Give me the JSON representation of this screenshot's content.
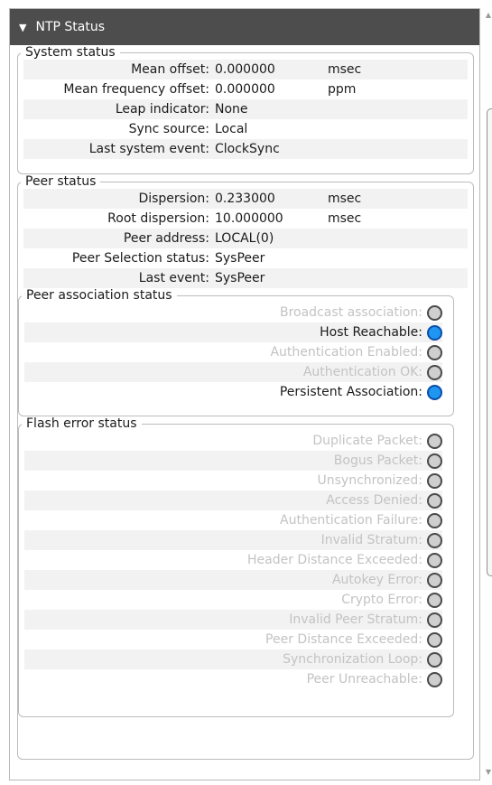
{
  "panel": {
    "title": "NTP Status"
  },
  "system_status": {
    "legend": "System status",
    "rows": [
      {
        "label": "Mean offset:",
        "value": "0.000000",
        "unit": "msec"
      },
      {
        "label": "Mean frequency offset:",
        "value": "0.000000",
        "unit": "ppm"
      },
      {
        "label": "Leap indicator:",
        "value": "None",
        "unit": ""
      },
      {
        "label": "Sync source:",
        "value": "Local",
        "unit": ""
      },
      {
        "label": "Last system event:",
        "value": "ClockSync",
        "unit": ""
      }
    ]
  },
  "peer_status": {
    "legend": "Peer status",
    "rows": [
      {
        "label": "Dispersion:",
        "value": "0.233000",
        "unit": "msec"
      },
      {
        "label": "Root dispersion:",
        "value": "10.000000",
        "unit": "msec"
      },
      {
        "label": "Peer address:",
        "value": "LOCAL(0)",
        "unit": ""
      },
      {
        "label": "Peer Selection status:",
        "value": "SysPeer",
        "unit": ""
      },
      {
        "label": "Last event:",
        "value": "SysPeer",
        "unit": ""
      }
    ],
    "association": {
      "legend": "Peer association status",
      "items": [
        {
          "label": "Broadcast association:",
          "active": false
        },
        {
          "label": "Host Reachable:",
          "active": true
        },
        {
          "label": "Authentication Enabled:",
          "active": false
        },
        {
          "label": "Authentication OK:",
          "active": false
        },
        {
          "label": "Persistent Association:",
          "active": true
        }
      ]
    },
    "flash_errors": {
      "legend": "Flash error status",
      "items": [
        {
          "label": "Duplicate Packet:",
          "active": false
        },
        {
          "label": "Bogus Packet:",
          "active": false
        },
        {
          "label": "Unsynchronized:",
          "active": false
        },
        {
          "label": "Access Denied:",
          "active": false
        },
        {
          "label": "Authentication Failure:",
          "active": false
        },
        {
          "label": "Invalid Stratum:",
          "active": false
        },
        {
          "label": "Header Distance Exceeded:",
          "active": false
        },
        {
          "label": "Autokey Error:",
          "active": false
        },
        {
          "label": "Crypto Error:",
          "active": false
        },
        {
          "label": "Invalid Peer Stratum:",
          "active": false
        },
        {
          "label": "Peer Distance Exceeded:",
          "active": false
        },
        {
          "label": "Synchronization Loop:",
          "active": false
        },
        {
          "label": "Peer Unreachable:",
          "active": false
        }
      ]
    }
  },
  "colors": {
    "header_bg": "#4d4d4d",
    "indicator_on": "#1e96f2",
    "indicator_off": "#cfcfcf",
    "inactive_text": "#c3c3c3",
    "row_shade": "#f2f2f2"
  }
}
